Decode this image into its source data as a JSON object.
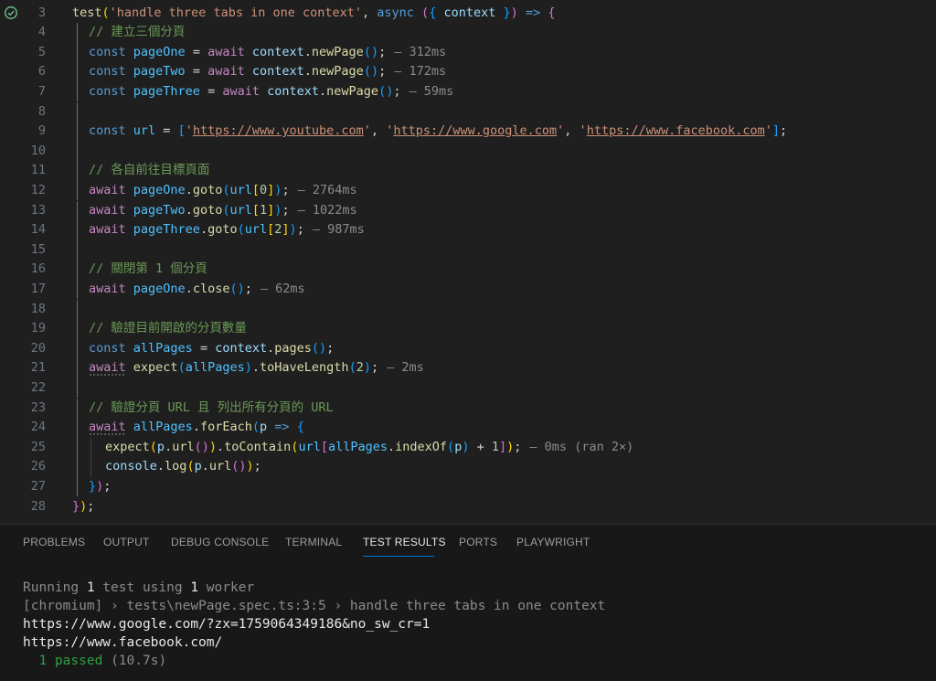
{
  "editor": {
    "lines": [
      {
        "n": "3",
        "tokens": [
          [
            "fn",
            "test"
          ],
          [
            "b1",
            "("
          ],
          [
            "str",
            "'handle three tabs in one context'"
          ],
          [
            "pun",
            ", "
          ],
          [
            "kw",
            "async"
          ],
          [
            "pun",
            " "
          ],
          [
            "b2",
            "("
          ],
          [
            "b3",
            "{"
          ],
          [
            "pun",
            " "
          ],
          [
            "var",
            "context"
          ],
          [
            "pun",
            " "
          ],
          [
            "b3",
            "}"
          ],
          [
            "b2",
            ")"
          ],
          [
            "pun",
            " "
          ],
          [
            "kw",
            "=>"
          ],
          [
            "pun",
            " "
          ],
          [
            "b2",
            "{"
          ]
        ]
      },
      {
        "n": "4",
        "tokens": [
          [
            "cmt",
            "// 建立三個分頁"
          ]
        ]
      },
      {
        "n": "5",
        "tokens": [
          [
            "kw",
            "const"
          ],
          [
            "pun",
            " "
          ],
          [
            "cst",
            "pageOne"
          ],
          [
            "pun",
            " = "
          ],
          [
            "ctl",
            "await"
          ],
          [
            "pun",
            " "
          ],
          [
            "var",
            "context"
          ],
          [
            "pun",
            "."
          ],
          [
            "fn",
            "newPage"
          ],
          [
            "b3",
            "()"
          ],
          [
            "pun",
            ";"
          ]
        ],
        "timing": "— 312ms"
      },
      {
        "n": "6",
        "tokens": [
          [
            "kw",
            "const"
          ],
          [
            "pun",
            " "
          ],
          [
            "cst",
            "pageTwo"
          ],
          [
            "pun",
            " = "
          ],
          [
            "ctl",
            "await"
          ],
          [
            "pun",
            " "
          ],
          [
            "var",
            "context"
          ],
          [
            "pun",
            "."
          ],
          [
            "fn",
            "newPage"
          ],
          [
            "b3",
            "()"
          ],
          [
            "pun",
            ";"
          ]
        ],
        "timing": "— 172ms"
      },
      {
        "n": "7",
        "tokens": [
          [
            "kw",
            "const"
          ],
          [
            "pun",
            " "
          ],
          [
            "cst",
            "pageThree"
          ],
          [
            "pun",
            " = "
          ],
          [
            "ctl",
            "await"
          ],
          [
            "pun",
            " "
          ],
          [
            "var",
            "context"
          ],
          [
            "pun",
            "."
          ],
          [
            "fn",
            "newPage"
          ],
          [
            "b3",
            "()"
          ],
          [
            "pun",
            ";"
          ]
        ],
        "timing": "— 59ms"
      },
      {
        "n": "8",
        "tokens": []
      },
      {
        "n": "9",
        "tokens": [
          [
            "kw",
            "const"
          ],
          [
            "pun",
            " "
          ],
          [
            "cst",
            "url"
          ],
          [
            "pun",
            " = "
          ],
          [
            "b3",
            "["
          ],
          [
            "str",
            "'"
          ],
          [
            "url",
            "https://www.youtube.com"
          ],
          [
            "str",
            "'"
          ],
          [
            "pun",
            ", "
          ],
          [
            "str",
            "'"
          ],
          [
            "url",
            "https://www.google.com"
          ],
          [
            "str",
            "'"
          ],
          [
            "pun",
            ", "
          ],
          [
            "str",
            "'"
          ],
          [
            "url",
            "https://www.facebook.com"
          ],
          [
            "str",
            "'"
          ],
          [
            "b3",
            "]"
          ],
          [
            "pun",
            ";"
          ]
        ]
      },
      {
        "n": "10",
        "tokens": []
      },
      {
        "n": "11",
        "tokens": [
          [
            "cmt",
            "// 各自前往目標頁面"
          ]
        ]
      },
      {
        "n": "12",
        "tokens": [
          [
            "ctl",
            "await"
          ],
          [
            "pun",
            " "
          ],
          [
            "cst",
            "pageOne"
          ],
          [
            "pun",
            "."
          ],
          [
            "fn",
            "goto"
          ],
          [
            "b3",
            "("
          ],
          [
            "cst",
            "url"
          ],
          [
            "b1",
            "["
          ],
          [
            "num",
            "0"
          ],
          [
            "b1",
            "]"
          ],
          [
            "b3",
            ")"
          ],
          [
            "pun",
            ";"
          ]
        ],
        "timing": "— 2764ms"
      },
      {
        "n": "13",
        "tokens": [
          [
            "ctl",
            "await"
          ],
          [
            "pun",
            " "
          ],
          [
            "cst",
            "pageTwo"
          ],
          [
            "pun",
            "."
          ],
          [
            "fn",
            "goto"
          ],
          [
            "b3",
            "("
          ],
          [
            "cst",
            "url"
          ],
          [
            "b1",
            "["
          ],
          [
            "num",
            "1"
          ],
          [
            "b1",
            "]"
          ],
          [
            "b3",
            ")"
          ],
          [
            "pun",
            ";"
          ]
        ],
        "timing": "— 1022ms"
      },
      {
        "n": "14",
        "tokens": [
          [
            "ctl",
            "await"
          ],
          [
            "pun",
            " "
          ],
          [
            "cst",
            "pageThree"
          ],
          [
            "pun",
            "."
          ],
          [
            "fn",
            "goto"
          ],
          [
            "b3",
            "("
          ],
          [
            "cst",
            "url"
          ],
          [
            "b1",
            "["
          ],
          [
            "num",
            "2"
          ],
          [
            "b1",
            "]"
          ],
          [
            "b3",
            ")"
          ],
          [
            "pun",
            ";"
          ]
        ],
        "timing": "— 987ms"
      },
      {
        "n": "15",
        "tokens": []
      },
      {
        "n": "16",
        "tokens": [
          [
            "cmt",
            "// 關閉第 1 個分頁"
          ]
        ]
      },
      {
        "n": "17",
        "tokens": [
          [
            "ctl",
            "await"
          ],
          [
            "pun",
            " "
          ],
          [
            "cst",
            "pageOne"
          ],
          [
            "pun",
            "."
          ],
          [
            "fn",
            "close"
          ],
          [
            "b3",
            "()"
          ],
          [
            "pun",
            ";"
          ]
        ],
        "timing": "— 62ms"
      },
      {
        "n": "18",
        "tokens": []
      },
      {
        "n": "19",
        "tokens": [
          [
            "cmt",
            "// 驗證目前開啟的分頁數量"
          ]
        ]
      },
      {
        "n": "20",
        "tokens": [
          [
            "kw",
            "const"
          ],
          [
            "pun",
            " "
          ],
          [
            "cst",
            "allPages"
          ],
          [
            "pun",
            " = "
          ],
          [
            "var",
            "context"
          ],
          [
            "pun",
            "."
          ],
          [
            "fn",
            "pages"
          ],
          [
            "b3",
            "()"
          ],
          [
            "pun",
            ";"
          ]
        ]
      },
      {
        "n": "21",
        "tokens": [
          [
            "ctl squig",
            "await"
          ],
          [
            "pun",
            " "
          ],
          [
            "fn",
            "expect"
          ],
          [
            "b3",
            "("
          ],
          [
            "cst",
            "allPages"
          ],
          [
            "b3",
            ")"
          ],
          [
            "pun",
            "."
          ],
          [
            "fn",
            "toHaveLength"
          ],
          [
            "b3",
            "("
          ],
          [
            "num",
            "2"
          ],
          [
            "b3",
            ")"
          ],
          [
            "pun",
            ";"
          ]
        ],
        "timing": "— 2ms"
      },
      {
        "n": "22",
        "tokens": []
      },
      {
        "n": "23",
        "tokens": [
          [
            "cmt",
            "// 驗證分頁 URL 且 列出所有分頁的 URL"
          ]
        ]
      },
      {
        "n": "24",
        "tokens": [
          [
            "ctl squig",
            "await"
          ],
          [
            "pun",
            " "
          ],
          [
            "cst",
            "allPages"
          ],
          [
            "pun",
            "."
          ],
          [
            "fn",
            "forEach"
          ],
          [
            "b3",
            "("
          ],
          [
            "var",
            "p"
          ],
          [
            "pun",
            " "
          ],
          [
            "kw",
            "=>"
          ],
          [
            "pun",
            " "
          ],
          [
            "b3",
            "{"
          ]
        ]
      },
      {
        "n": "25",
        "indent": 1,
        "tokens": [
          [
            "fn",
            "expect"
          ],
          [
            "b1",
            "("
          ],
          [
            "var",
            "p"
          ],
          [
            "pun",
            "."
          ],
          [
            "fn",
            "url"
          ],
          [
            "b2",
            "()"
          ],
          [
            "b1",
            ")"
          ],
          [
            "pun",
            "."
          ],
          [
            "fn",
            "toContain"
          ],
          [
            "b1",
            "("
          ],
          [
            "cst",
            "url"
          ],
          [
            "b2",
            "["
          ],
          [
            "cst",
            "allPages"
          ],
          [
            "pun",
            "."
          ],
          [
            "fn",
            "indexOf"
          ],
          [
            "b3",
            "("
          ],
          [
            "var",
            "p"
          ],
          [
            "b3",
            ")"
          ],
          [
            "pun",
            " + "
          ],
          [
            "num",
            "1"
          ],
          [
            "b2",
            "]"
          ],
          [
            "b1",
            ")"
          ],
          [
            "pun",
            ";"
          ]
        ],
        "timing": "— 0ms (ran 2×)"
      },
      {
        "n": "26",
        "indent": 1,
        "tokens": [
          [
            "var",
            "console"
          ],
          [
            "pun",
            "."
          ],
          [
            "fn",
            "log"
          ],
          [
            "b1",
            "("
          ],
          [
            "var",
            "p"
          ],
          [
            "pun",
            "."
          ],
          [
            "fn",
            "url"
          ],
          [
            "b2",
            "()"
          ],
          [
            "b1",
            ")"
          ],
          [
            "pun",
            ";"
          ]
        ]
      },
      {
        "n": "27",
        "tokens": [
          [
            "b3",
            "}"
          ],
          [
            "b2",
            ")"
          ],
          [
            "pun",
            ";"
          ]
        ]
      },
      {
        "n": "28",
        "outer": true,
        "tokens": [
          [
            "b2",
            "}"
          ],
          [
            "b1",
            ")"
          ],
          [
            "pun",
            ";"
          ]
        ]
      }
    ]
  },
  "panel": {
    "tabs": [
      {
        "label": "PROBLEMS",
        "active": false
      },
      {
        "label": "OUTPUT",
        "active": false
      },
      {
        "label": "DEBUG CONSOLE",
        "active": false
      },
      {
        "label": "TERMINAL",
        "active": false
      },
      {
        "label": "TEST RESULTS",
        "active": true
      },
      {
        "label": "PORTS",
        "active": false
      },
      {
        "label": "PLAYWRIGHT",
        "active": false
      }
    ],
    "output": {
      "running_prefix": "Running ",
      "test_count": "1",
      "running_mid": " test using ",
      "worker_count": "1",
      "running_suffix": " worker",
      "test_path": "[chromium] › tests\\newPage.spec.ts:3:5 › handle three tabs in one context",
      "log_lines": [
        "https://www.google.com/?zx=1759064349186&no_sw_cr=1",
        "https://www.facebook.com/"
      ],
      "summary_count": "1",
      "summary_label": "passed",
      "summary_time": "(10.7s)"
    }
  },
  "icons": {
    "test_status": "check-circle-icon",
    "pass_color": "#73c991"
  }
}
